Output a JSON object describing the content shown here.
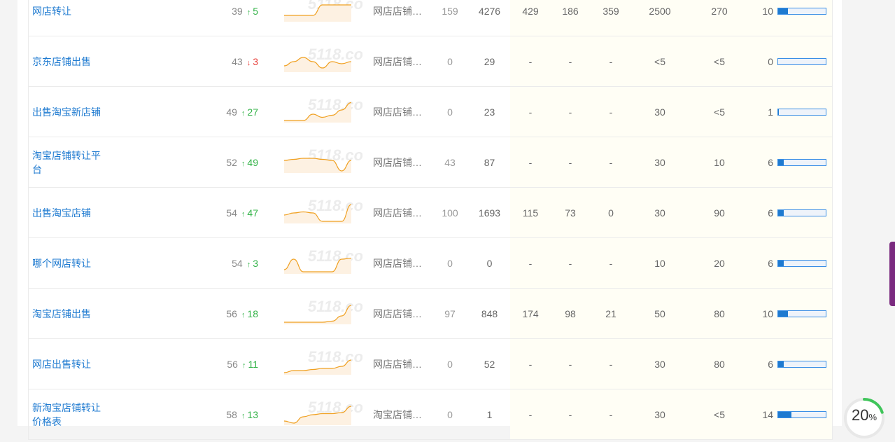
{
  "rows": [
    {
      "keyword": "网店转让",
      "rank": "39",
      "dir": "up",
      "change": "5",
      "category": "网店店铺…",
      "v1": "159",
      "v2": "4276",
      "v3": "429",
      "v4": "186",
      "v5": "359",
      "v6": "2500",
      "v7": "270",
      "competition": "10",
      "comp_fill": 0.2,
      "trend": [
        0.3,
        0.3,
        0.3,
        0.3,
        0.8,
        0.8,
        0.8,
        0.8
      ]
    },
    {
      "keyword": "京东店铺出售",
      "rank": "43",
      "dir": "down",
      "change": "3",
      "category": "网店店铺…",
      "v1": "0",
      "v2": "29",
      "v3": "-",
      "v4": "-",
      "v5": "-",
      "v6": "<5",
      "v7": "<5",
      "competition": "0",
      "comp_fill": 0.0,
      "trend": [
        0.3,
        0.5,
        0.7,
        0.5,
        0.2,
        0.5,
        0.4,
        0.5
      ]
    },
    {
      "keyword": "出售淘宝新店铺",
      "rank": "49",
      "dir": "up",
      "change": "27",
      "category": "网店店铺…",
      "v1": "0",
      "v2": "23",
      "v3": "-",
      "v4": "-",
      "v5": "-",
      "v6": "30",
      "v7": "<5",
      "competition": "1",
      "comp_fill": 0.02,
      "trend": [
        0.1,
        0.1,
        0.1,
        0.4,
        0.25,
        0.35,
        0.6,
        0.95
      ]
    },
    {
      "keyword": "淘宝店铺转让平台",
      "rank": "52",
      "dir": "up",
      "change": "49",
      "category": "网店店铺…",
      "v1": "43",
      "v2": "87",
      "v3": "-",
      "v4": "-",
      "v5": "-",
      "v6": "30",
      "v7": "10",
      "competition": "6",
      "comp_fill": 0.12,
      "trend": [
        0.6,
        0.65,
        0.7,
        0.7,
        0.65,
        0.6,
        0.1,
        0.6
      ]
    },
    {
      "keyword": "出售淘宝店铺",
      "rank": "54",
      "dir": "up",
      "change": "47",
      "category": "网店店铺…",
      "v1": "100",
      "v2": "1693",
      "v3": "115",
      "v4": "73",
      "v5": "0",
      "v6": "30",
      "v7": "90",
      "competition": "6",
      "comp_fill": 0.12,
      "trend": [
        0.4,
        0.5,
        0.55,
        0.5,
        0.1,
        0.1,
        0.1,
        0.9
      ]
    },
    {
      "keyword": "哪个网店转让",
      "rank": "54",
      "dir": "up",
      "change": "3",
      "category": "网店店铺…",
      "v1": "0",
      "v2": "0",
      "v3": "-",
      "v4": "-",
      "v5": "-",
      "v6": "10",
      "v7": "20",
      "competition": "6",
      "comp_fill": 0.12,
      "trend": [
        0.2,
        0.7,
        0.1,
        0.1,
        0.1,
        0.1,
        0.7,
        0.75
      ]
    },
    {
      "keyword": "淘宝店铺出售",
      "rank": "56",
      "dir": "up",
      "change": "18",
      "category": "网店店铺…",
      "v1": "97",
      "v2": "848",
      "v3": "174",
      "v4": "98",
      "v5": "21",
      "v6": "50",
      "v7": "80",
      "competition": "10",
      "comp_fill": 0.2,
      "trend": [
        0.1,
        0.1,
        0.1,
        0.1,
        0.1,
        0.15,
        0.4,
        0.9
      ]
    },
    {
      "keyword": "网店出售转让",
      "rank": "56",
      "dir": "up",
      "change": "11",
      "category": "网店店铺…",
      "v1": "0",
      "v2": "52",
      "v3": "-",
      "v4": "-",
      "v5": "-",
      "v6": "30",
      "v7": "80",
      "competition": "6",
      "comp_fill": 0.12,
      "trend": [
        0.1,
        0.2,
        0.2,
        0.25,
        0.3,
        0.3,
        0.4,
        0.7
      ]
    },
    {
      "keyword": "新淘宝店铺转让价格表",
      "rank": "58",
      "dir": "up",
      "change": "13",
      "category": "淘宝店铺…",
      "v1": "0",
      "v2": "1",
      "v3": "-",
      "v4": "-",
      "v5": "-",
      "v6": "30",
      "v7": "<5",
      "competition": "14",
      "comp_fill": 0.28,
      "trend": [
        0.2,
        0.1,
        0.4,
        0.5,
        0.55,
        0.55,
        0.6,
        0.9
      ]
    }
  ],
  "watermark": "5118.com",
  "progress": {
    "value": "20",
    "unit": "%",
    "fraction": 0.2
  }
}
